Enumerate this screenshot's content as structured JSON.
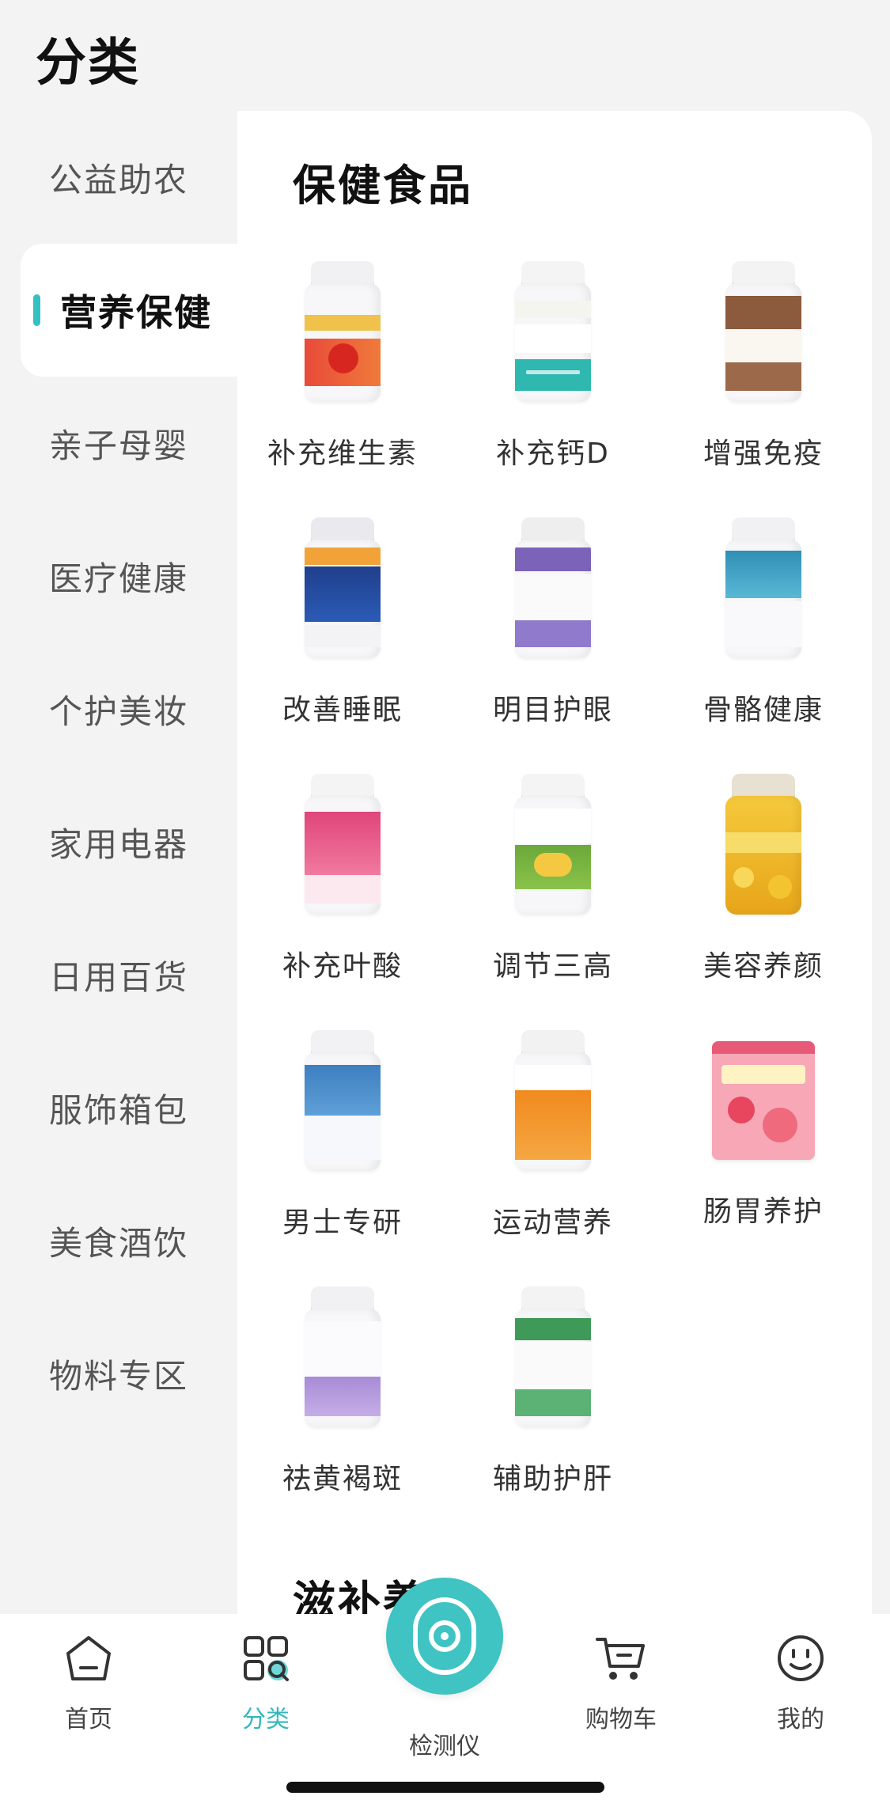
{
  "page": {
    "title": "分类"
  },
  "sidebar": {
    "items": [
      {
        "label": "公益助农",
        "active": false
      },
      {
        "label": "营养保健",
        "active": true
      },
      {
        "label": "亲子母婴",
        "active": false
      },
      {
        "label": "医疗健康",
        "active": false
      },
      {
        "label": "个护美妆",
        "active": false
      },
      {
        "label": "家用电器",
        "active": false
      },
      {
        "label": "日用百货",
        "active": false
      },
      {
        "label": "服饰箱包",
        "active": false
      },
      {
        "label": "美食酒饮",
        "active": false
      },
      {
        "label": "物料专区",
        "active": false
      }
    ]
  },
  "main": {
    "section_title": "保健食品",
    "items": [
      {
        "label": "补充维生素",
        "image": "tomato-supplement-bottle"
      },
      {
        "label": "补充钙D",
        "image": "calcium-d-bottle"
      },
      {
        "label": "增强免疫",
        "image": "immunity-softgel-bottle"
      },
      {
        "label": "改善睡眠",
        "image": "melatonin-b6-bottle"
      },
      {
        "label": "明目护眼",
        "image": "lutein-tablet-bottle"
      },
      {
        "label": "骨骼健康",
        "image": "bone-health-bottle"
      },
      {
        "label": "补充叶酸",
        "image": "folic-acid-bottle"
      },
      {
        "label": "调节三高",
        "image": "fish-oil-softgel-bottle"
      },
      {
        "label": "美容养颜",
        "image": "vitamin-e-softgel-jar"
      },
      {
        "label": "男士专研",
        "image": "men-multivitamin-bottle"
      },
      {
        "label": "运动营养",
        "image": "sports-nutrition-bottle"
      },
      {
        "label": "肠胃养护",
        "image": "probiotic-box"
      },
      {
        "label": "祛黄褐斑",
        "image": "skin-care-bottle"
      },
      {
        "label": "辅助护肝",
        "image": "liver-care-bottle"
      }
    ],
    "next_section_title": "滋补养生"
  },
  "bottom_nav": {
    "items": [
      {
        "label": "首页",
        "icon": "home-icon"
      },
      {
        "label": "分类",
        "icon": "category-grid-icon"
      },
      {
        "label": "检测仪",
        "icon": "detector-icon"
      },
      {
        "label": "购物车",
        "icon": "cart-icon"
      },
      {
        "label": "我的",
        "icon": "smile-face-icon"
      }
    ],
    "active_index": 1
  },
  "colors": {
    "accent": "#35c0c2",
    "center_button": "#3fc3c3",
    "background": "#f3f3f3"
  }
}
